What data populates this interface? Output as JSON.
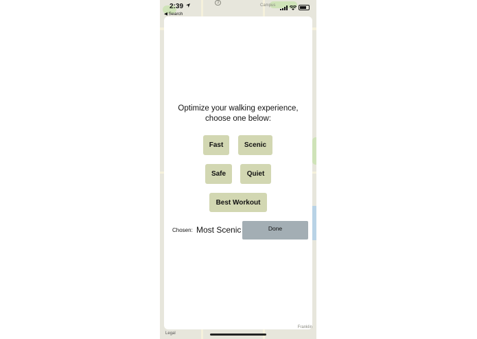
{
  "status_bar": {
    "time": "2:39",
    "back_label": "◀ Search",
    "location_icon": "location-arrow-icon"
  },
  "map": {
    "top_label": "Campus",
    "route_badge": "3",
    "legal": "Legal",
    "bottom_right_label": "Franklin"
  },
  "modal": {
    "prompt_line1": "Optimize your walking experience,",
    "prompt_line2": "choose one below:",
    "options": {
      "fast": "Fast",
      "scenic": "Scenic",
      "safe": "Safe",
      "quiet": "Quiet",
      "best_workout": "Best Workout"
    },
    "chosen_label": "Chosen:",
    "chosen_value": "Most Scenic",
    "done_label": "Done"
  },
  "colors": {
    "option_bg": "#d2d7b2",
    "done_bg": "#a3aeb4",
    "map_bg": "#e7e6dc"
  }
}
